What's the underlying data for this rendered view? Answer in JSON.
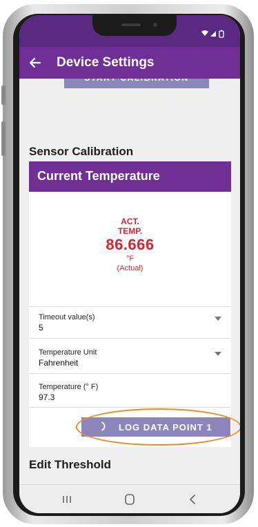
{
  "appbar": {
    "title": "Device Settings"
  },
  "top_button": {
    "label": "START CALIBRATION"
  },
  "sections": {
    "sensor_calibration": "Sensor Calibration",
    "edit_threshold": "Edit Threshold"
  },
  "card": {
    "header": "Current Temperature",
    "reading": {
      "label_line1": "ACT.",
      "label_line2": "TEMP.",
      "value": "86.666",
      "unit": "°F",
      "note": "(Actual)"
    }
  },
  "fields": [
    {
      "label": "Timeout value(s)",
      "value": "5"
    },
    {
      "label": "Temperature Unit",
      "value": "Fahrenheit"
    },
    {
      "label": "Temperature (° F)",
      "value": "97.3"
    }
  ],
  "log_button": {
    "label": "LOG DATA POINT 1"
  },
  "colors": {
    "primary": "#6f2f95",
    "button": "#8c86bd",
    "reading": "#d7242f",
    "highlight": "#f08a1d"
  },
  "icons": [
    "back-arrow-icon",
    "wifi-icon",
    "signal-icon",
    "battery-icon",
    "spinner-icon",
    "recent-apps-icon",
    "home-icon",
    "back-nav-icon"
  ]
}
